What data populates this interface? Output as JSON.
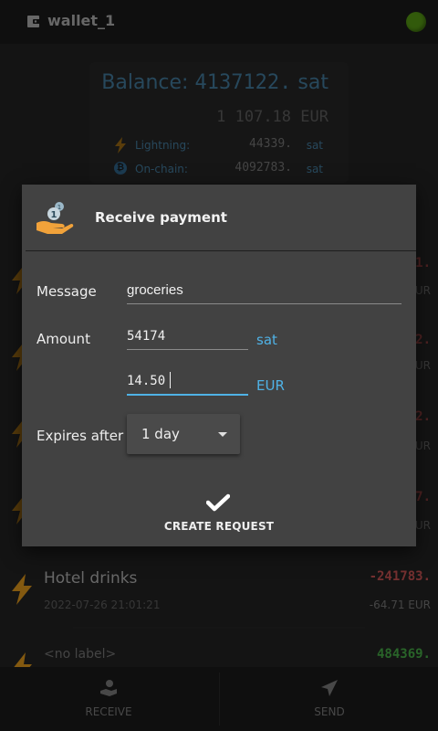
{
  "app": {
    "wallet_name": "wallet_1",
    "icons": {
      "wallet": "wallet-icon",
      "status": "connection-status-icon"
    }
  },
  "balance": {
    "label": "Balance:",
    "amount": "4137122.",
    "unit": "sat",
    "fiat_amount": "1 107.18",
    "fiat_unit": "EUR",
    "lightning": {
      "label": "Lightning:",
      "amount": "44339.",
      "unit": "sat"
    },
    "onchain": {
      "label": "On-chain:",
      "amount": "4092783.",
      "unit": "sat"
    }
  },
  "transactions": [
    {
      "amount": "1.",
      "fiat": "UR"
    },
    {
      "amount": "2.",
      "fiat": "UR"
    },
    {
      "amount": "2.",
      "fiat": "UR"
    },
    {
      "amount": "7.",
      "fiat": "UR"
    },
    {
      "label": "Hotel drinks",
      "date": "2022-07-26 21:01:21",
      "amount": "-241783.",
      "fiat": "-64.71 EUR"
    },
    {
      "label": "<no label>",
      "amount": "484369."
    }
  ],
  "dialog": {
    "title": "Receive payment",
    "message_label": "Message",
    "message_value": "groceries",
    "amount_label": "Amount",
    "amount_sat_value": "54174",
    "amount_sat_unit": "sat",
    "amount_fiat_value": "14.50",
    "amount_fiat_unit": "EUR",
    "expires_label": "Expires after",
    "expires_value": "1 day",
    "create_label": "CREATE REQUEST"
  },
  "nav": {
    "receive_label": "RECEIVE",
    "send_label": "SEND"
  },
  "colors": {
    "accent": "#4fb2e6",
    "lightning": "#c9891a",
    "negative": "#b34a4a",
    "positive": "#3f9a3f",
    "status_online": "#4d8a12"
  }
}
